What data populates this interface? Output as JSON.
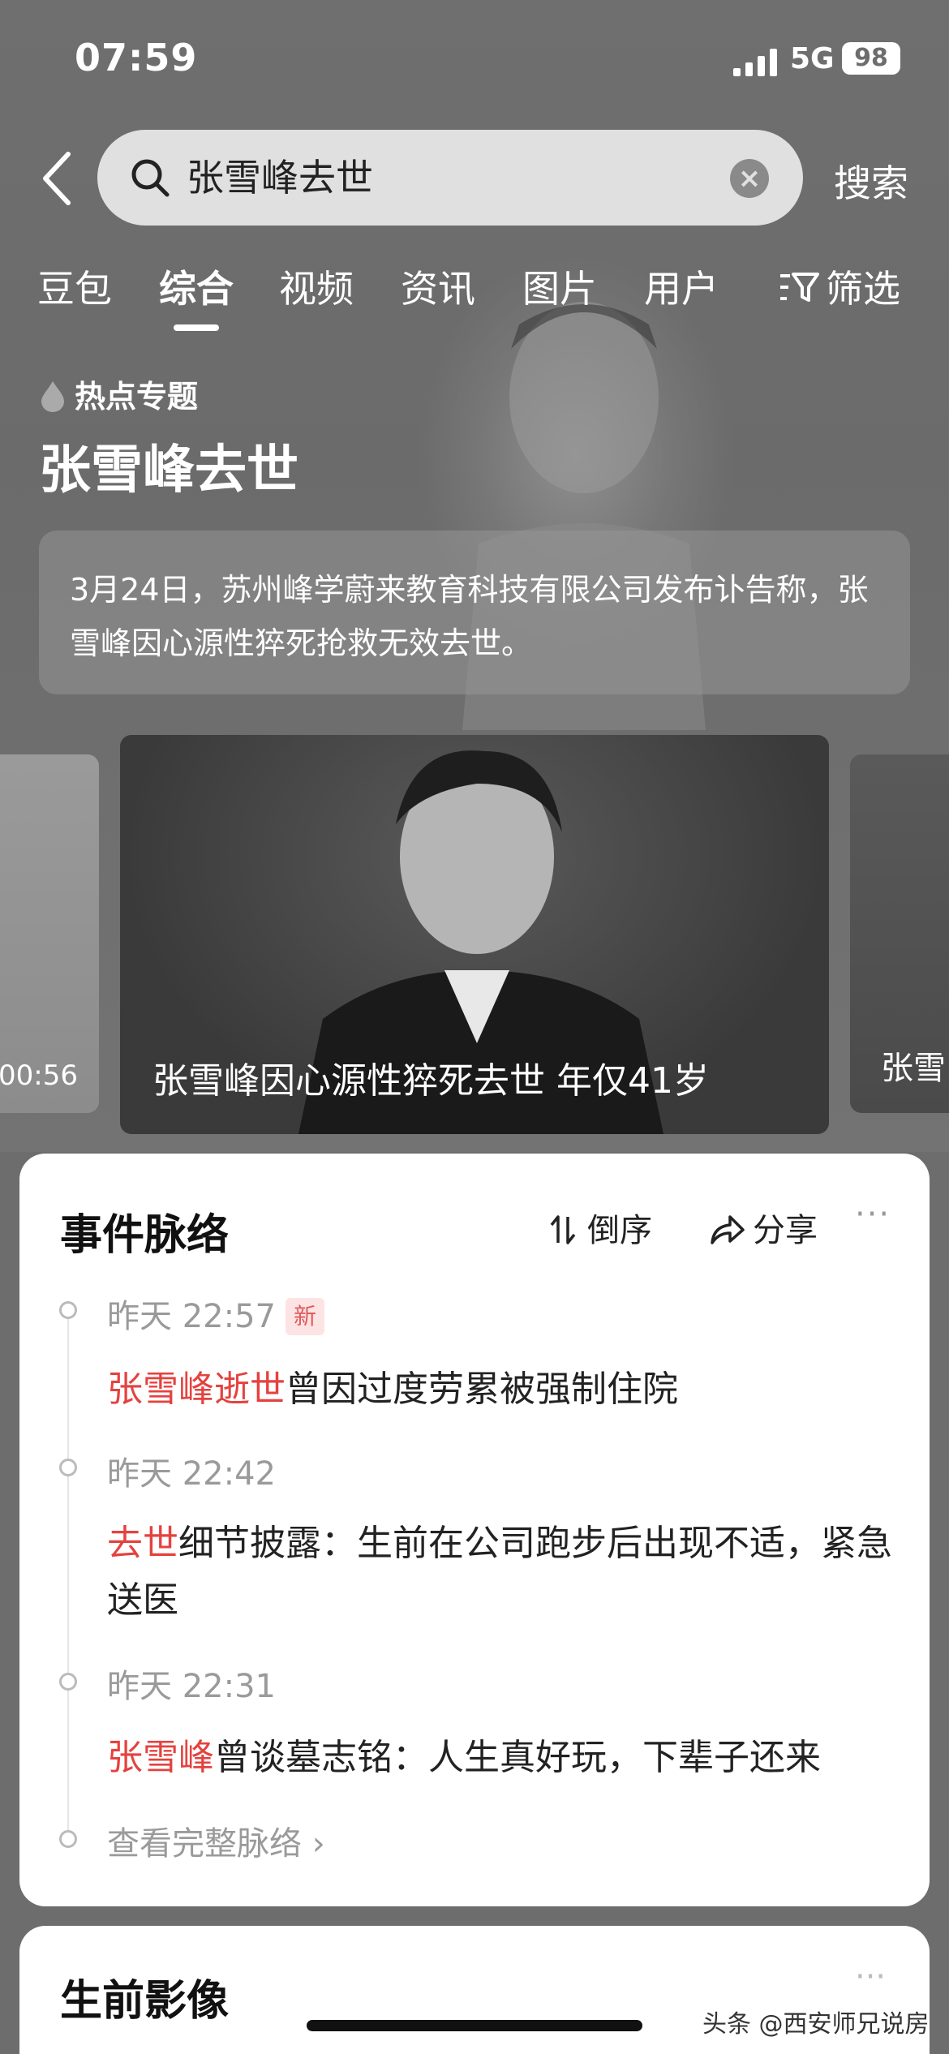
{
  "status_bar": {
    "time": "07:59",
    "network": "5G",
    "battery": "98"
  },
  "search": {
    "query": "张雪峰去世",
    "button_label": "搜索"
  },
  "tabs": [
    {
      "label": "豆包"
    },
    {
      "label": "综合",
      "active": true
    },
    {
      "label": "视频"
    },
    {
      "label": "资讯"
    },
    {
      "label": "图片"
    },
    {
      "label": "用户"
    }
  ],
  "filter_label": "筛选",
  "hot_topic": {
    "label": "热点专题",
    "title": "张雪峰去世",
    "summary": "3月24日，苏州峰学蔚来教育科技有限公司发布讣告称，张雪峰因心源性猝死抢救无效去世。"
  },
  "carousel": {
    "left_duration": "00:56",
    "main_caption": "张雪峰因心源性猝死去世 年仅41岁",
    "right_caption": "张雪"
  },
  "timeline": {
    "title": "事件脉络",
    "sort_label": "倒序",
    "share_label": "分享",
    "more_label": "···",
    "items": [
      {
        "time": "昨天 22:57",
        "badge": "新",
        "highlight": "张雪峰逝世",
        "text": "曾因过度劳累被强制住院"
      },
      {
        "time": "昨天 22:42",
        "badge": "",
        "highlight": "去世",
        "text": "细节披露：生前在公司跑步后出现不适，紧急送医"
      },
      {
        "time": "昨天 22:31",
        "badge": "",
        "highlight": "张雪峰",
        "text": "曾谈墓志铭：人生真好玩，下辈子还来"
      }
    ],
    "view_all_label": "查看完整脉络 ›"
  },
  "section2": {
    "title": "生前影像",
    "more_label": "···"
  },
  "watermark": "头条 @西安师兄说房"
}
